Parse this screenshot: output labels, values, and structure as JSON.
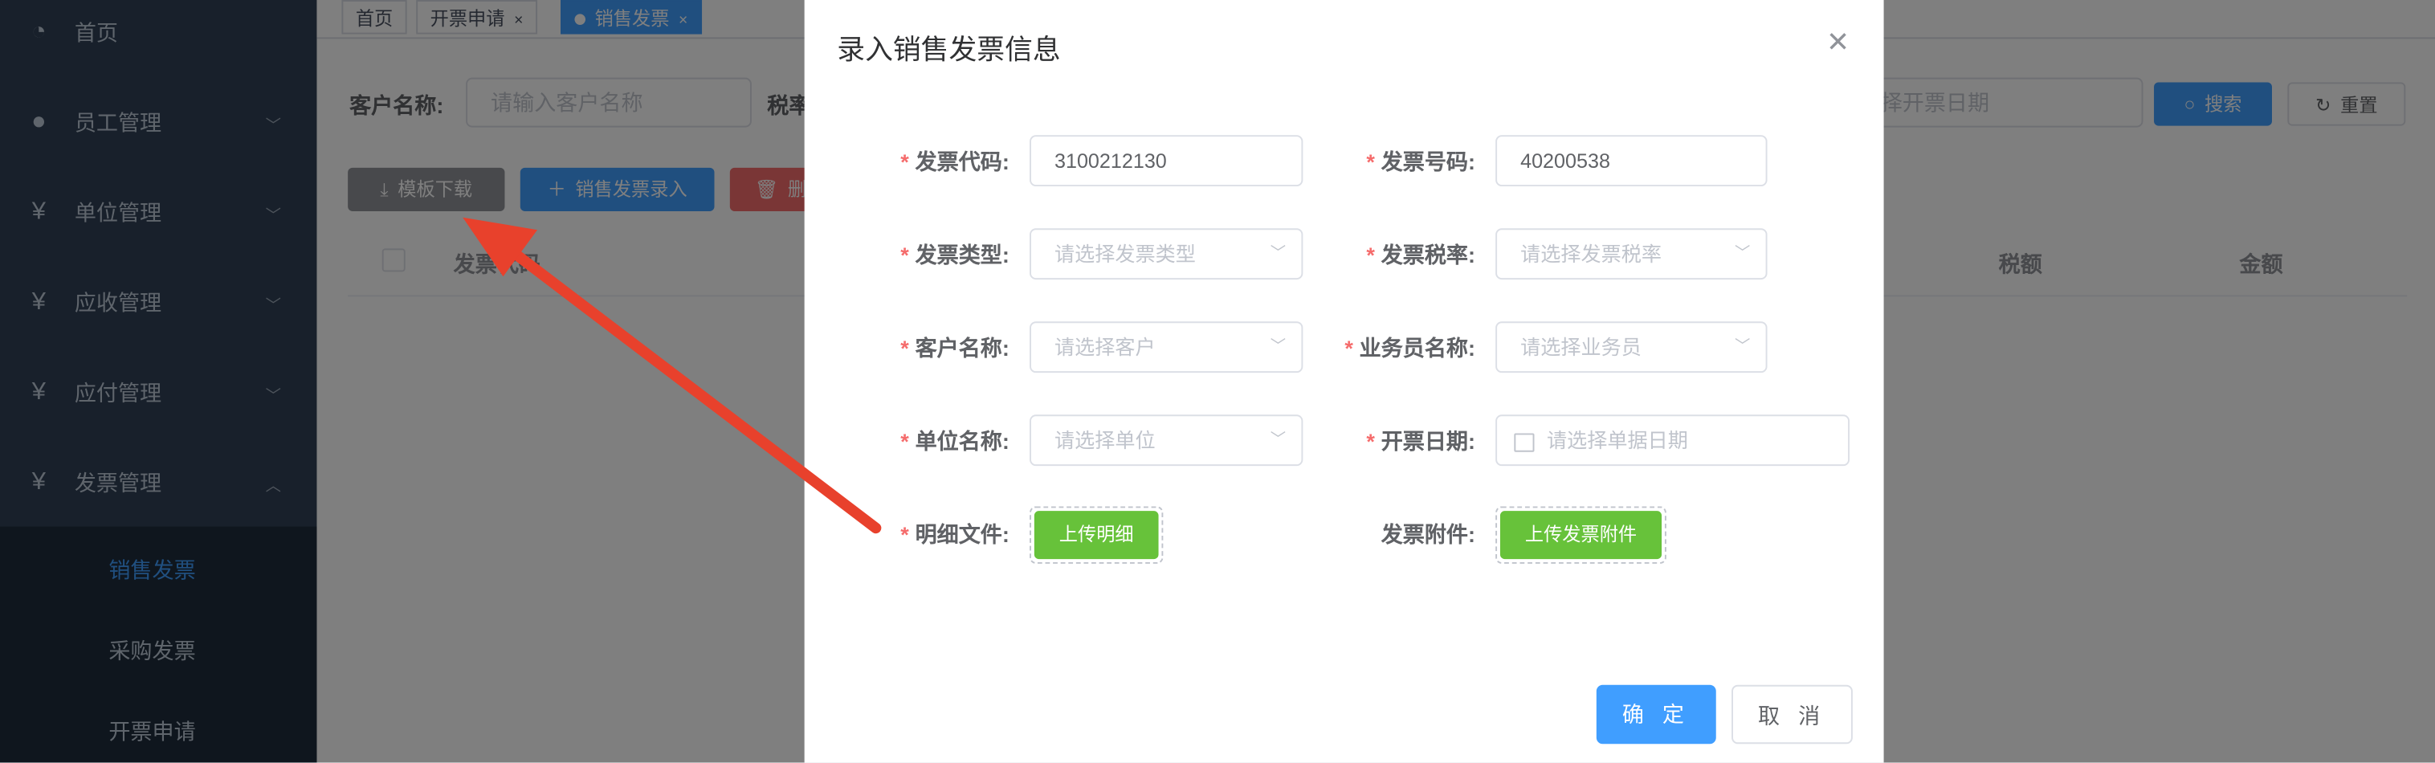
{
  "sidebar": {
    "items": [
      {
        "icon": "dashboard-icon",
        "label": "首页"
      },
      {
        "icon": "user-icon",
        "label": "员工管理"
      },
      {
        "icon": "yen-icon",
        "label": "单位管理"
      },
      {
        "icon": "yen-icon",
        "label": "应收管理"
      },
      {
        "icon": "yen-icon",
        "label": "应付管理"
      },
      {
        "icon": "yen-icon",
        "label": "发票管理"
      }
    ],
    "submenu": [
      "销售发票",
      "采购发票",
      "开票申请"
    ],
    "active_sub": "销售发票"
  },
  "tags": [
    {
      "label": "首页",
      "closable": false,
      "active": false
    },
    {
      "label": "开票申请",
      "closable": true,
      "active": false
    },
    {
      "label": "销售发票",
      "closable": true,
      "active": true
    }
  ],
  "filters": {
    "customer_label": "客户名称:",
    "customer_placeholder": "请输入客户名称",
    "tax_label_partial": "税率",
    "date_placeholder_partial": "择开票日期",
    "search_label": "搜索",
    "reset_label": "重置"
  },
  "toolbar": {
    "template_download": "模板下载",
    "sales_invoice_entry": "销售发票录入",
    "delete_partial": "删"
  },
  "table": {
    "columns_visible": [
      "发票代码",
      "税额",
      "金额"
    ]
  },
  "dialog": {
    "title": "录入销售发票信息",
    "fields": {
      "invoice_code": {
        "label": "发票代码:",
        "value": "3100212130",
        "required": true
      },
      "invoice_number": {
        "label": "发票号码:",
        "value": "40200538",
        "required": true
      },
      "invoice_type": {
        "label": "发票类型:",
        "placeholder": "请选择发票类型",
        "required": true
      },
      "tax_rate": {
        "label": "发票税率:",
        "placeholder": "请选择发票税率",
        "required": true
      },
      "customer": {
        "label": "客户名称:",
        "placeholder": "请选择客户",
        "required": true
      },
      "salesperson": {
        "label": "业务员名称:",
        "placeholder": "请选择业务员",
        "required": true
      },
      "unit": {
        "label": "单位名称:",
        "placeholder": "请选择单位",
        "required": true
      },
      "issue_date": {
        "label": "开票日期:",
        "placeholder": "请选择单据日期",
        "required": true
      },
      "detail_file": {
        "label": "明细文件:",
        "button": "上传明细",
        "required": true
      },
      "attachment": {
        "label": "发票附件:",
        "button": "上传发票附件",
        "required": false
      }
    },
    "confirm": "确 定",
    "cancel": "取 消"
  },
  "colors": {
    "sidebar_bg": "#304156",
    "primary": "#409eff",
    "success": "#67c23a",
    "danger": "#f56c6c",
    "annotation_arrow": "#e8412c"
  }
}
